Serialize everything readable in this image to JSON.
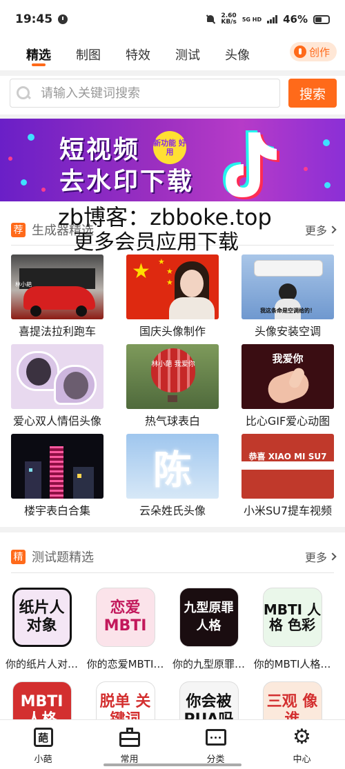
{
  "status_bar": {
    "time": "19:45",
    "net_speed_value": "2.60",
    "net_speed_unit": "KB/s",
    "network": "5G HD",
    "battery_pct": "46%"
  },
  "tabs": [
    {
      "label": "精选",
      "active": true
    },
    {
      "label": "制图",
      "active": false
    },
    {
      "label": "特效",
      "active": false
    },
    {
      "label": "测试",
      "active": false
    },
    {
      "label": "头像",
      "active": false
    }
  ],
  "create_label": "创作",
  "search": {
    "placeholder": "请输入关键词搜索",
    "button": "搜索"
  },
  "banner": {
    "line1": "短视频",
    "line2": "去水印下载",
    "badge": "新功能 好用"
  },
  "watermark": {
    "line1": "zb博客：zbboke.top",
    "line2": "更多会员应用下载"
  },
  "generators": {
    "badge": "荐",
    "title": "生成器精选",
    "more": "更多",
    "items": [
      {
        "label": "喜提法拉利跑车",
        "thumb_text": "林小葩",
        "icon": "ferrari-showroom-image"
      },
      {
        "label": "国庆头像制作",
        "thumb_text": "",
        "icon": "china-flag-portrait-image"
      },
      {
        "label": "头像安装空调",
        "thumb_text": "我这条命是空调给的！",
        "icon": "air-conditioner-image"
      },
      {
        "label": "爱心双人情侣头像",
        "thumb_text": "",
        "icon": "heart-couple-avatar-image"
      },
      {
        "label": "热气球表白",
        "thumb_text": "林小葩 我爱你",
        "icon": "hot-air-balloon-image"
      },
      {
        "label": "比心GIF爱心动图",
        "thumb_text": "我爱你",
        "icon": "finger-heart-image"
      },
      {
        "label": "楼宇表白合集",
        "thumb_text": "",
        "icon": "building-lights-image"
      },
      {
        "label": "云朵姓氏头像",
        "thumb_text": "陈",
        "icon": "cloud-surname-image"
      },
      {
        "label": "小米SU7提车视频",
        "thumb_text": "恭喜 XIAO MI SU7",
        "icon": "xiaomi-su7-image"
      }
    ]
  },
  "quizzes": {
    "badge": "精",
    "title": "测试题精选",
    "more": "更多",
    "items": [
      {
        "label": "你的纸片人对…",
        "icon_text": "纸片人 对象",
        "bg": "#f4e6f5",
        "color": "#111"
      },
      {
        "label": "你的恋爱MBTI…",
        "icon_text": "恋爱 MBTI",
        "bg": "#fbe3ea",
        "color": "#c2185b"
      },
      {
        "label": "你的九型原罪…",
        "icon_text": "九型原罪 人格",
        "bg": "#1a0d10",
        "color": "#fff"
      },
      {
        "label": "你的MBTI人格…",
        "icon_text": "MBTI 人格 色彩",
        "bg": "#eaf7ea",
        "color": "#111"
      }
    ],
    "row2": [
      {
        "icon_text": "MBTI 人格",
        "bg": "#d32f2f",
        "color": "#fff"
      },
      {
        "icon_text": "脱单 关键词",
        "bg": "#fff",
        "color": "#d32f2f"
      },
      {
        "icon_text": "你会被 PUA吗",
        "bg": "#f5f5f5",
        "color": "#111"
      },
      {
        "icon_text": "三观 像谁",
        "bg": "#fbe9dc",
        "color": "#d32f2f"
      }
    ]
  },
  "bottom_nav": [
    {
      "label": "小葩",
      "icon": "pa-logo-icon"
    },
    {
      "label": "常用",
      "icon": "toolbox-icon"
    },
    {
      "label": "分类",
      "icon": "chat-bubble-icon"
    },
    {
      "label": "中心",
      "icon": "gear-icon"
    }
  ],
  "colors": {
    "accent": "#ff6a1a"
  }
}
